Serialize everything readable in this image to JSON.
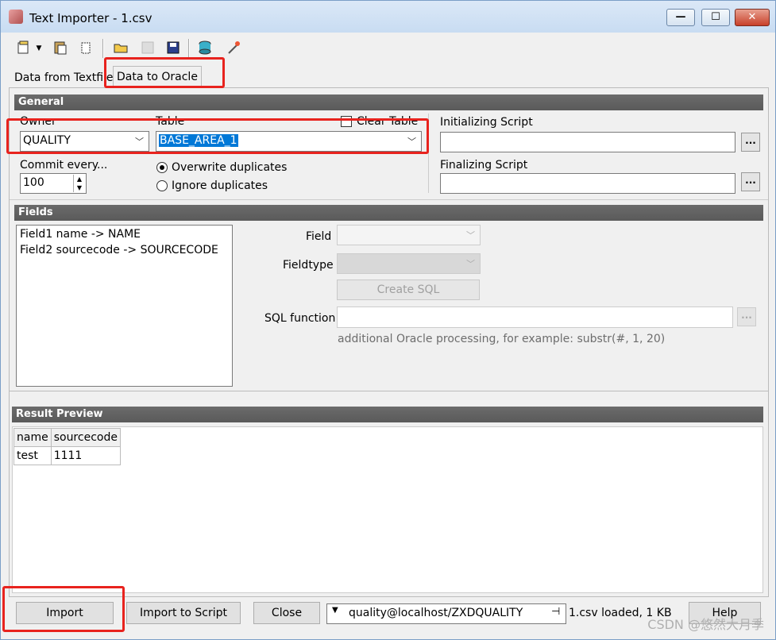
{
  "window": {
    "title": "Text Importer - 1.csv",
    "min_glyph": "—",
    "max_glyph": "☐",
    "close_glyph": "✕"
  },
  "toolbar": {
    "icons": [
      "new-icon",
      "paste-icon",
      "clear-icon",
      "open-folder-icon",
      "save-disabled-icon",
      "save-icon",
      "database-icon",
      "wand-icon"
    ]
  },
  "tabs": [
    {
      "label": "Data from Textfile"
    },
    {
      "label": "Data to Oracle",
      "active": true
    }
  ],
  "general": {
    "header": "General",
    "owner_label": "Owner",
    "owner_value": "QUALITY",
    "table_label": "Table",
    "table_value": "BASE_AREA_1",
    "clear_table_label": "Clear Table",
    "commit_label": "Commit every...",
    "commit_value": "100",
    "overwrite_label": "Overwrite duplicates",
    "ignore_label": "Ignore duplicates",
    "init_script_label": "Initializing Script",
    "final_script_label": "Finalizing Script",
    "dots": "..."
  },
  "fields": {
    "header": "Fields",
    "items": [
      "Field1  name  ->  NAME",
      "Field2  sourcecode  ->  SOURCECODE"
    ],
    "field_label": "Field",
    "fieldtype_label": "Fieldtype",
    "create_sql": "Create SQL",
    "sql_function_label": "SQL function",
    "hint": "additional Oracle processing, for example: substr(#, 1, 20)"
  },
  "result": {
    "header": "Result Preview",
    "columns": [
      "name",
      "sourcecode"
    ],
    "rows": [
      [
        "test",
        "1111"
      ]
    ]
  },
  "bottom": {
    "import": "Import",
    "import_script": "Import to Script",
    "close": "Close",
    "connection": "quality@localhost/ZXDQUALITY",
    "status": "1.csv loaded,  1 KB",
    "help": "Help"
  },
  "watermark": "CSDN @悠然大月季"
}
